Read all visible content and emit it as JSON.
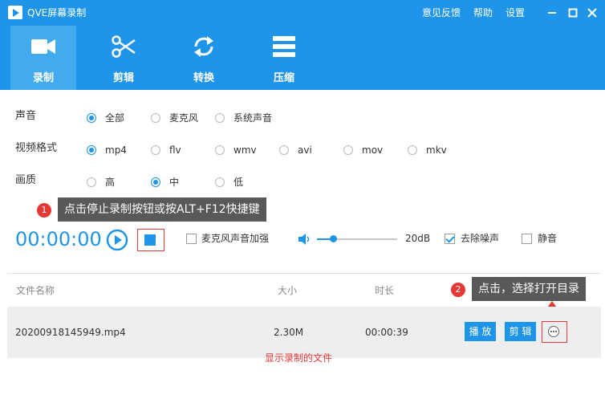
{
  "window": {
    "title": "QVE屏幕录制",
    "links": [
      "意见反馈",
      "帮助",
      "设置"
    ]
  },
  "toolbar": {
    "tabs": [
      {
        "label": "录制",
        "icon": "video-camera-icon",
        "active": true
      },
      {
        "label": "剪辑",
        "icon": "scissors-icon",
        "active": false
      },
      {
        "label": "转换",
        "icon": "convert-arrows-icon",
        "active": false
      },
      {
        "label": "压缩",
        "icon": "compress-icon",
        "active": false
      }
    ]
  },
  "options": {
    "audio": {
      "label": "声音",
      "choices": [
        "全部",
        "麦克风",
        "系统声音"
      ],
      "selected": "全部"
    },
    "format": {
      "label": "视频格式",
      "choices": [
        "mp4",
        "flv",
        "wmv",
        "avi",
        "mov",
        "mkv"
      ],
      "selected": "mp4"
    },
    "quality": {
      "label": "画质",
      "choices": [
        "高",
        "中",
        "低"
      ],
      "selected": "中"
    }
  },
  "callouts": {
    "one": {
      "num": "1",
      "text": "点击停止录制按钮或按ALT+F12快捷键"
    },
    "two": {
      "num": "2",
      "text": "点击，选择打开目录"
    },
    "file_hint": "显示录制的文件"
  },
  "recorder": {
    "timer": "00:00:00",
    "mic_boost_label": "麦克风声音加强",
    "volume_db": "20dB",
    "volume_level": 0.2,
    "denoise_label": "去除噪声",
    "denoise_checked": true,
    "mute_label": "静音",
    "mute_checked": false
  },
  "file_list": {
    "headers": {
      "name": "文件名称",
      "size": "大小",
      "duration": "时长"
    },
    "rows": [
      {
        "name": "20200918145949.mp4",
        "size": "2.30M",
        "duration": "00:00:39",
        "play_label": "播 放",
        "edit_label": "剪 辑"
      }
    ]
  },
  "colors": {
    "accent": "#1e95e8",
    "tab_active": "#42abf0",
    "annotation_red": "#e53935",
    "callout_bg": "#595959"
  }
}
